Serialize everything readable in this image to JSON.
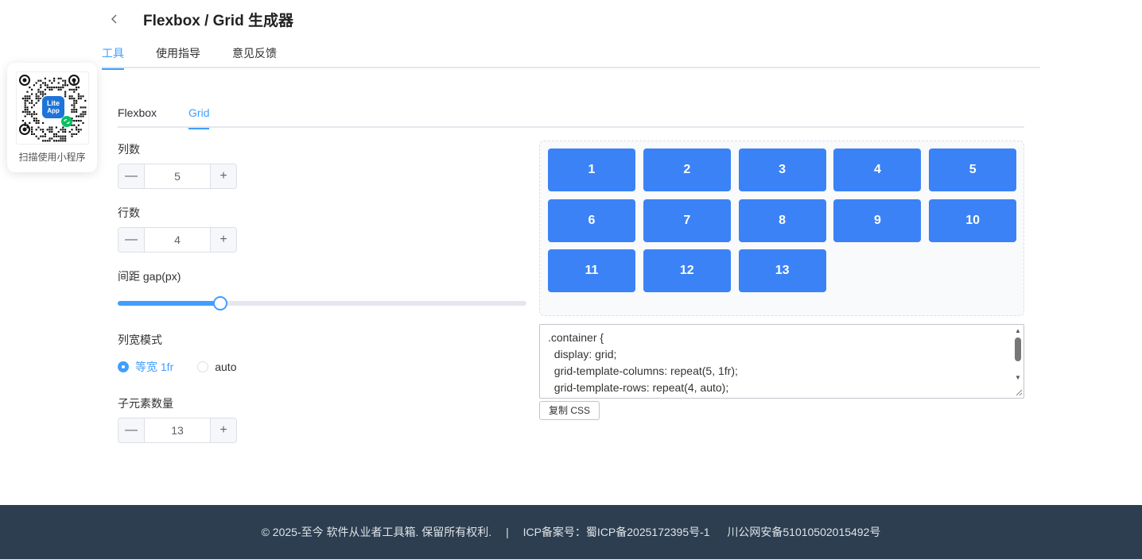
{
  "header": {
    "back_icon": "chevron-left-icon",
    "title": "Flexbox / Grid 生成器",
    "tabs": [
      "工具",
      "使用指导",
      "意见反馈"
    ]
  },
  "qr_card": {
    "badge_text": "Lite App",
    "caption": "扫描使用小程序"
  },
  "sub_tabs": [
    "Flexbox",
    "Grid"
  ],
  "controls": {
    "columns_label": "列数",
    "columns_value": "5",
    "rows_label": "行数",
    "rows_value": "4",
    "gap_label": "间距 gap(px)",
    "gap_fraction": 0.25,
    "width_mode_label": "列宽模式",
    "width_mode_options": [
      "等宽 1fr",
      "auto"
    ],
    "width_mode_selected": "等宽 1fr",
    "children_label": "子元素数量",
    "children_value": "13",
    "minus_symbol": "—",
    "plus_symbol": "+"
  },
  "preview": {
    "items": [
      "1",
      "2",
      "3",
      "4",
      "5",
      "6",
      "7",
      "8",
      "9",
      "10",
      "11",
      "12",
      "13"
    ],
    "item_color": "#3b82f6"
  },
  "css_output": {
    "code": ".container {\n  display: grid;\n  grid-template-columns: repeat(5, 1fr);\n  grid-template-rows: repeat(4, auto);",
    "copy_label": "复制 CSS"
  },
  "footer": {
    "copyright": "© 2025-至今 软件从业者工具箱. 保留所有权利.",
    "separator": "|",
    "icp": "ICP备案号：蜀ICP备2025172395号-1",
    "police": "川公网安备51010502015492号"
  },
  "colors": {
    "accent": "#409eff",
    "footer_bg": "#2c3e50"
  }
}
